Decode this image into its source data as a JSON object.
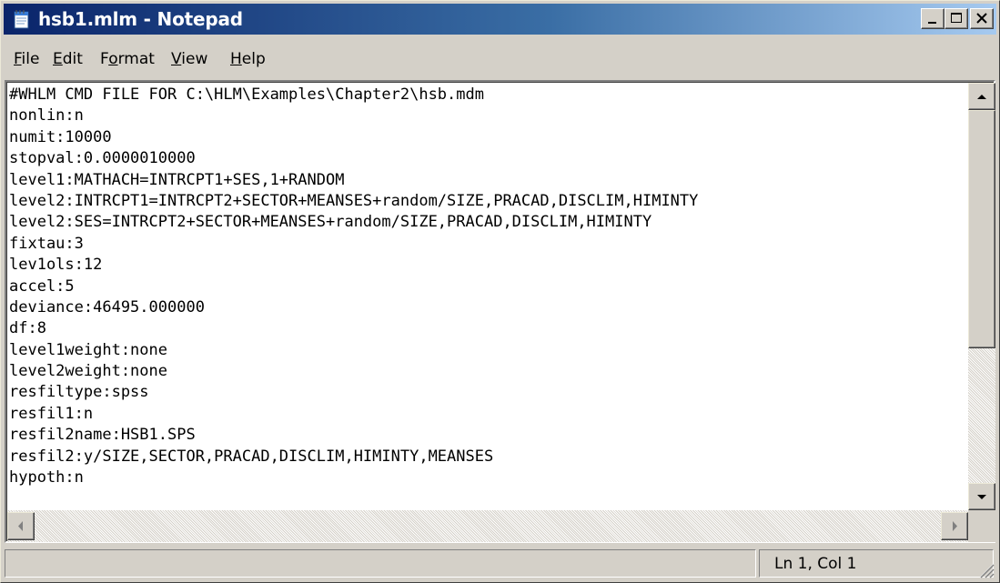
{
  "window": {
    "title": "hsb1.mlm - Notepad",
    "icon": "notepad-icon"
  },
  "caption_buttons": {
    "minimize": "minimize-icon",
    "maximize": "maximize-icon",
    "close": "close-icon"
  },
  "menu": {
    "items": [
      {
        "accel": "F",
        "rest": "ile"
      },
      {
        "accel": "E",
        "rest": "dit"
      },
      {
        "pre": "F",
        "accel": "o",
        "rest": "rmat"
      },
      {
        "accel": "V",
        "rest": "iew"
      },
      {
        "accel": "H",
        "rest": "elp"
      }
    ]
  },
  "editor": {
    "lines": [
      "#WHLM CMD FILE FOR C:\\HLM\\Examples\\Chapter2\\hsb.mdm",
      "nonlin:n",
      "numit:10000",
      "stopval:0.0000010000",
      "level1:MATHACH=INTRCPT1+SES,1+RANDOM",
      "level2:INTRCPT1=INTRCPT2+SECTOR+MEANSES+random/SIZE,PRACAD,DISCLIM,HIMINTY",
      "level2:SES=INTRCPT2+SECTOR+MEANSES+random/SIZE,PRACAD,DISCLIM,HIMINTY",
      "fixtau:3",
      "lev1ols:12",
      "accel:5",
      "deviance:46495.000000",
      "df:8",
      "level1weight:none",
      "level2weight:none",
      "resfiltype:spss",
      "resfil1:n",
      "resfil2name:HSB1.SPS",
      "resfil2:y/SIZE,SECTOR,PRACAD,DISCLIM,HIMINTY,MEANSES",
      "hypoth:n"
    ]
  },
  "statusbar": {
    "position": "Ln 1, Col 1"
  },
  "colors": {
    "titlebar_start": "#0a246a",
    "titlebar_end": "#a6caf0",
    "face": "#d4d0c8"
  }
}
